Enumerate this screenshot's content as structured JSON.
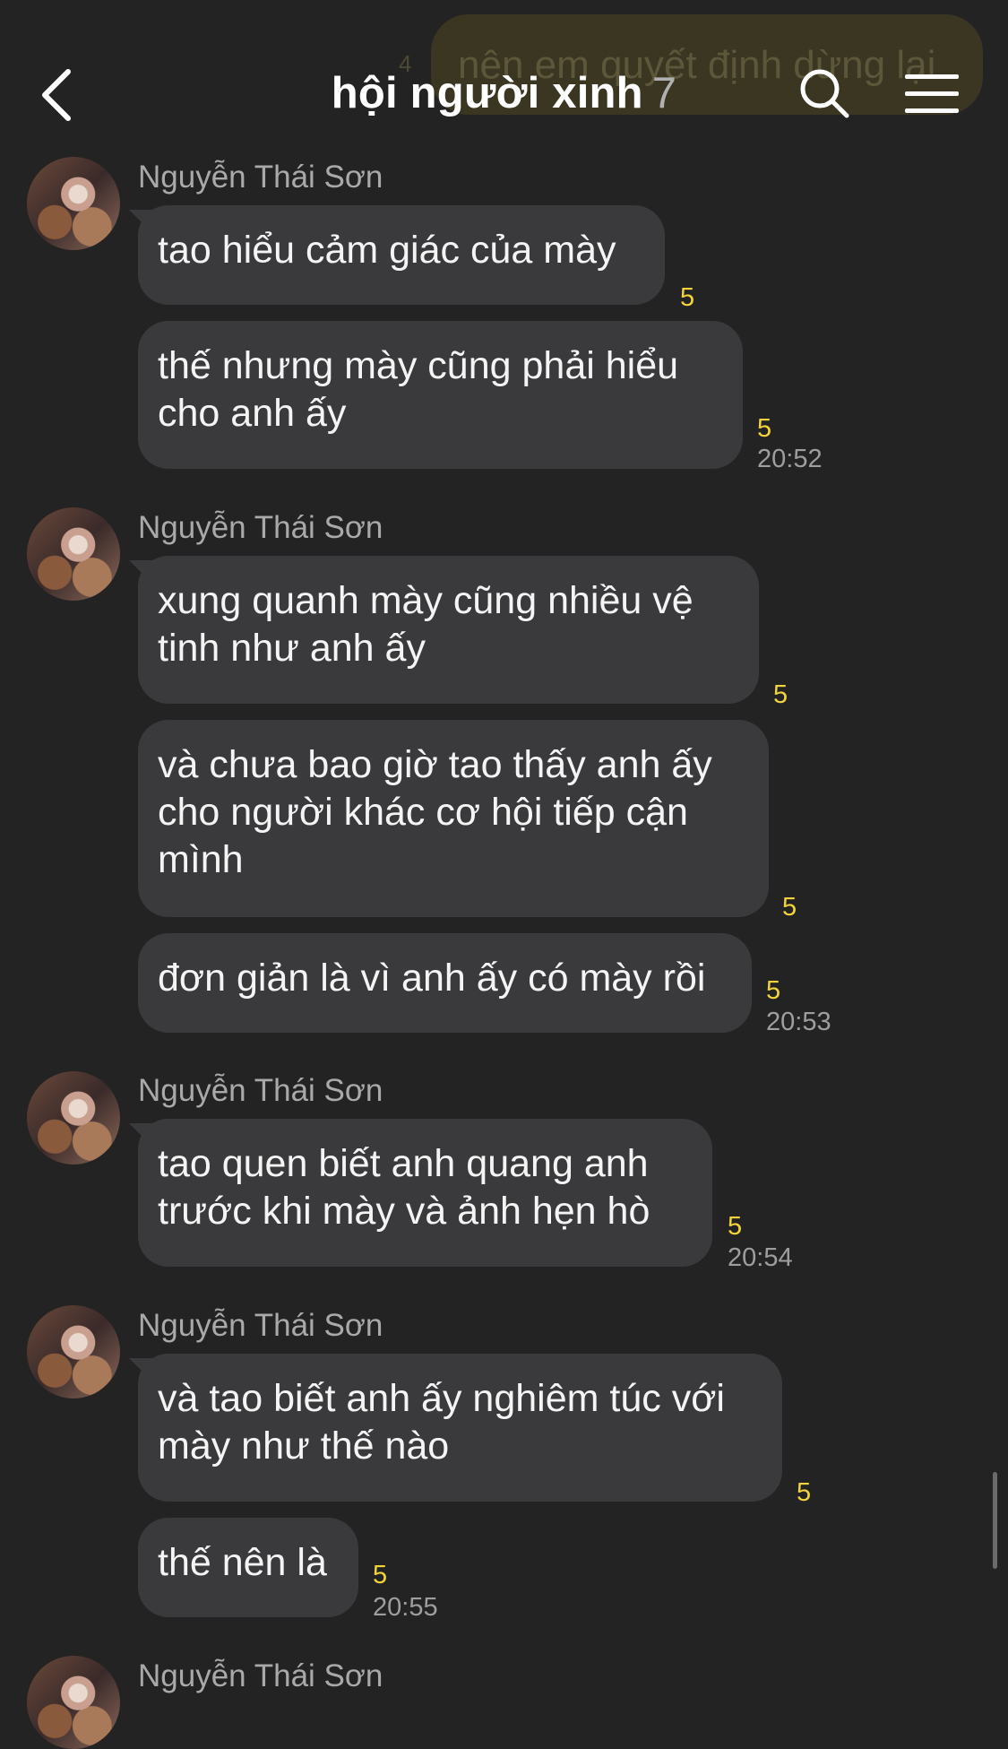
{
  "header": {
    "title": "hội người xinh",
    "member_count": "7",
    "back_icon": "chevron-left-icon",
    "search_icon": "search-icon",
    "menu_icon": "hamburger-menu-icon"
  },
  "pinned_preview": {
    "text": "nên em quyết định dừng lại",
    "count": "4"
  },
  "messages": [
    {
      "sender": "Nguyễn Thái Sơn",
      "bubbles": [
        {
          "lines": [
            "tao hiểu cảm giác của mày"
          ],
          "read": "5",
          "time": ""
        },
        {
          "lines": [
            "thế nhưng mày cũng phải hiểu",
            "cho anh ấy"
          ],
          "read": "5",
          "time": "20:52"
        }
      ]
    },
    {
      "sender": "Nguyễn Thái Sơn",
      "bubbles": [
        {
          "lines": [
            "xung quanh mày cũng nhiều vệ",
            "tinh như anh ấy"
          ],
          "read": "5",
          "time": ""
        },
        {
          "lines": [
            "và chưa bao giờ tao thấy anh ấy",
            "cho người khác cơ hội tiếp cận",
            "mình"
          ],
          "read": "5",
          "time": ""
        },
        {
          "lines": [
            "đơn giản là vì anh ấy có mày rồi"
          ],
          "read": "5",
          "time": "20:53"
        }
      ]
    },
    {
      "sender": "Nguyễn Thái Sơn",
      "bubbles": [
        {
          "lines": [
            "tao quen biết anh quang anh",
            "trước khi mày và ảnh hẹn hò"
          ],
          "read": "5",
          "time": "20:54"
        }
      ]
    },
    {
      "sender": "Nguyễn Thái Sơn",
      "bubbles": [
        {
          "lines": [
            "và tao biết anh ấy nghiêm túc với",
            "mày như thế nào"
          ],
          "read": "5",
          "time": ""
        },
        {
          "lines": [
            "thế nên là"
          ],
          "read": "5",
          "time": "20:55"
        }
      ]
    },
    {
      "sender": "Nguyễn Thái Sơn",
      "bubbles": []
    }
  ],
  "colors": {
    "background": "#232324",
    "bubble": "#3a3a3c",
    "read_count": "#f2d33a",
    "sender": "#a9a9a9"
  }
}
